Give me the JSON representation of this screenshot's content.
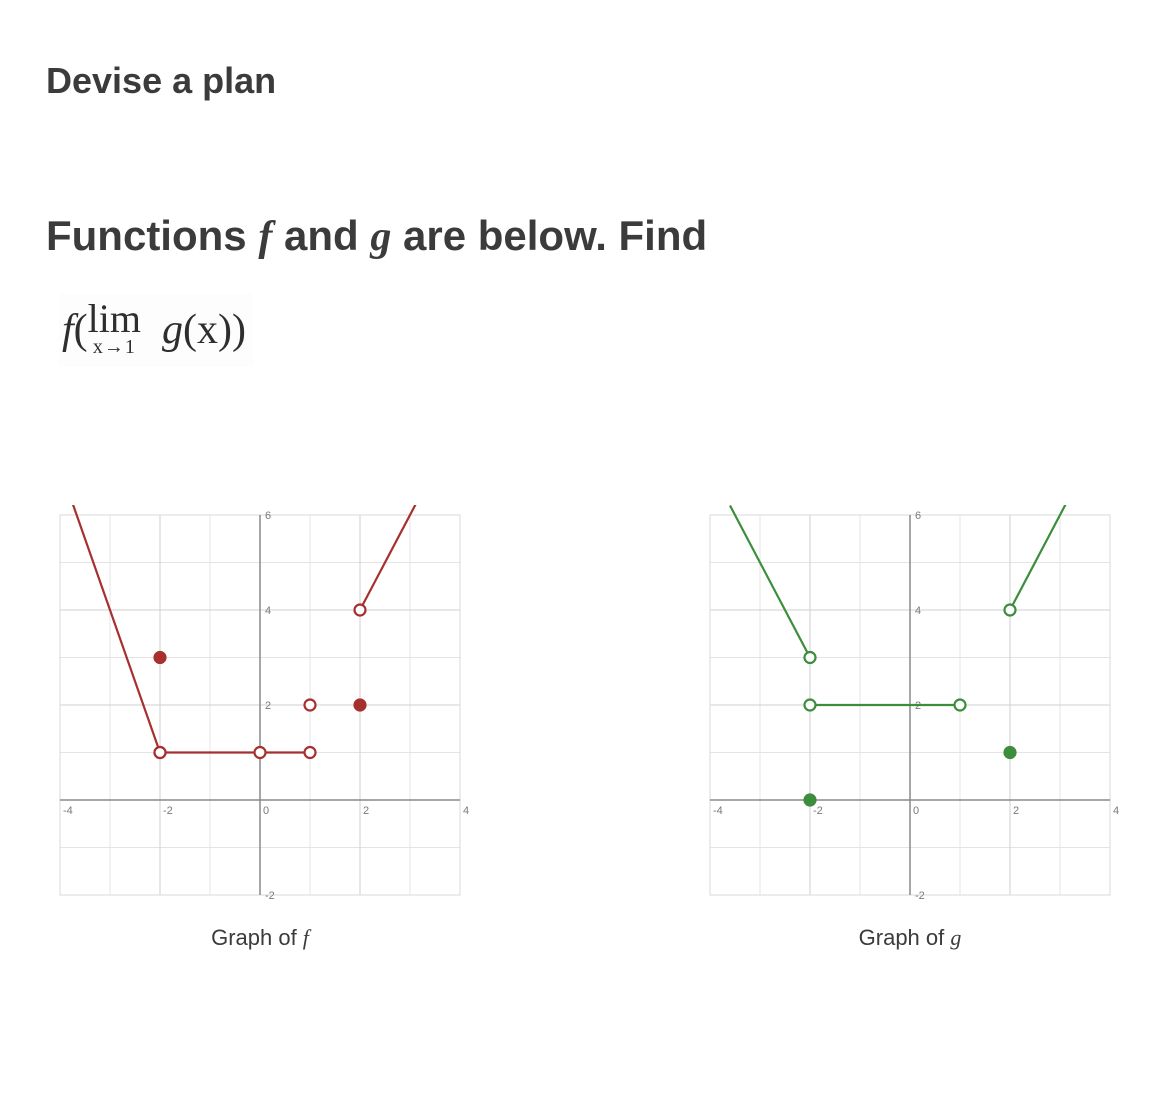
{
  "heading": "Devise a plan",
  "prompt_prefix": "Functions ",
  "fn_f": "f",
  "prompt_and": "  and ",
  "fn_g": "g",
  "prompt_suffix": " are below. Find",
  "limit": {
    "outer_f": "f",
    "open": "(",
    "lim": "lim",
    "approach": "x→1",
    "inner_g": "g",
    "of_x": "(x)",
    "close": ")"
  },
  "chart_f_caption_prefix": "Graph of ",
  "chart_f_caption_fn": "f",
  "chart_g_caption_prefix": "Graph of ",
  "chart_g_caption_fn": "g",
  "chart_data": [
    {
      "name": "f",
      "type": "line",
      "xlim": [
        -4,
        4
      ],
      "ylim": [
        -2,
        6
      ],
      "x_ticks": [
        -4,
        -2,
        0,
        2,
        4
      ],
      "y_ticks": [
        -2,
        0,
        2,
        4,
        6
      ],
      "color": "#a6302e",
      "segments": [
        {
          "kind": "ray",
          "from": [
            -2,
            1
          ],
          "through": [
            -4,
            7
          ],
          "open_start": true
        },
        {
          "kind": "segment",
          "from": [
            -2,
            1
          ],
          "to": [
            1,
            1
          ],
          "open_start": true,
          "open_end": true
        },
        {
          "kind": "ray",
          "from": [
            2,
            4
          ],
          "through": [
            4,
            8
          ],
          "open_start": true
        }
      ],
      "isolated_open": [
        [
          0,
          1
        ],
        [
          1,
          2
        ]
      ],
      "isolated_closed": [
        [
          -2,
          3
        ],
        [
          2,
          2
        ]
      ]
    },
    {
      "name": "g",
      "type": "line",
      "xlim": [
        -4,
        4
      ],
      "ylim": [
        -2,
        6
      ],
      "x_ticks": [
        -4,
        -2,
        0,
        2,
        4
      ],
      "y_ticks": [
        -2,
        0,
        2,
        4,
        6
      ],
      "color": "#3c8d3c",
      "segments": [
        {
          "kind": "ray",
          "from": [
            -2,
            3
          ],
          "through": [
            -4,
            7
          ],
          "open_start": true
        },
        {
          "kind": "segment",
          "from": [
            -2,
            2
          ],
          "to": [
            1,
            2
          ],
          "open_start": true,
          "open_end": true
        },
        {
          "kind": "ray",
          "from": [
            2,
            4
          ],
          "through": [
            4,
            8
          ],
          "open_start": true
        }
      ],
      "isolated_open": [],
      "isolated_closed": [
        [
          -2,
          0
        ],
        [
          2,
          1
        ]
      ]
    }
  ]
}
